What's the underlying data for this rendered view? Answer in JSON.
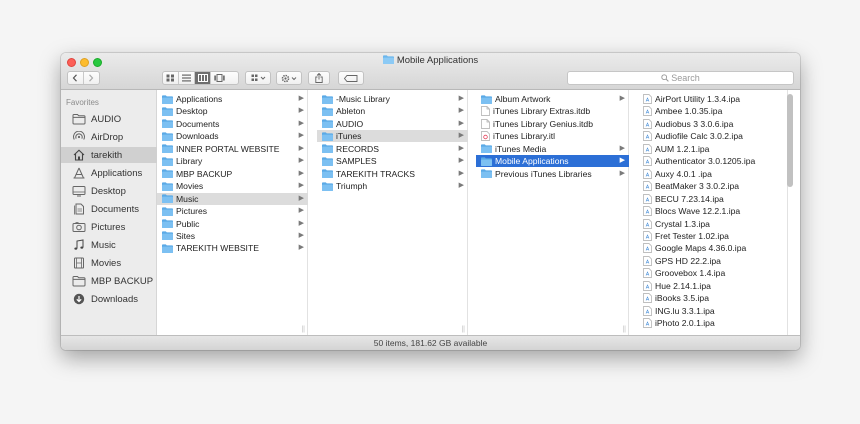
{
  "window": {
    "title": "Mobile Applications"
  },
  "search": {
    "placeholder": "Search"
  },
  "sidebar": {
    "heading": "Favorites",
    "items": [
      {
        "label": "AUDIO",
        "icon": "folder-icon"
      },
      {
        "label": "AirDrop",
        "icon": "airdrop-icon"
      },
      {
        "label": "tarekith",
        "icon": "home-icon",
        "selected": true
      },
      {
        "label": "Applications",
        "icon": "applications-icon"
      },
      {
        "label": "Desktop",
        "icon": "desktop-icon"
      },
      {
        "label": "Documents",
        "icon": "documents-icon"
      },
      {
        "label": "Pictures",
        "icon": "pictures-icon"
      },
      {
        "label": "Music",
        "icon": "music-icon"
      },
      {
        "label": "Movies",
        "icon": "movies-icon"
      },
      {
        "label": "MBP BACKUP",
        "icon": "folder-icon"
      },
      {
        "label": "Downloads",
        "icon": "downloads-icon"
      }
    ]
  },
  "columns": [
    {
      "items": [
        {
          "label": "Applications",
          "type": "folder"
        },
        {
          "label": "Desktop",
          "type": "folder"
        },
        {
          "label": "Documents",
          "type": "folder"
        },
        {
          "label": "Downloads",
          "type": "folder"
        },
        {
          "label": "INNER PORTAL WEBSITE",
          "type": "folder"
        },
        {
          "label": "Library",
          "type": "folder"
        },
        {
          "label": "MBP BACKUP",
          "type": "folder"
        },
        {
          "label": "Movies",
          "type": "folder"
        },
        {
          "label": "Music",
          "type": "folder",
          "selected": "grey"
        },
        {
          "label": "Pictures",
          "type": "folder"
        },
        {
          "label": "Public",
          "type": "folder"
        },
        {
          "label": "Sites",
          "type": "folder"
        },
        {
          "label": "TAREKITH WEBSITE",
          "type": "folder"
        }
      ]
    },
    {
      "items": [
        {
          "label": "-Music Library",
          "type": "folder"
        },
        {
          "label": "Ableton",
          "type": "folder"
        },
        {
          "label": "AUDIO",
          "type": "folder"
        },
        {
          "label": "iTunes",
          "type": "folder",
          "selected": "grey"
        },
        {
          "label": "RECORDS",
          "type": "folder"
        },
        {
          "label": "SAMPLES",
          "type": "folder"
        },
        {
          "label": "TAREKITH TRACKS",
          "type": "folder"
        },
        {
          "label": "Triumph",
          "type": "folder"
        }
      ]
    },
    {
      "items": [
        {
          "label": "Album Artwork",
          "type": "folder"
        },
        {
          "label": "iTunes Library Extras.itdb",
          "type": "file"
        },
        {
          "label": "iTunes Library Genius.itdb",
          "type": "file"
        },
        {
          "label": "iTunes Library.itl",
          "type": "itl"
        },
        {
          "label": "iTunes Media",
          "type": "folder"
        },
        {
          "label": "Mobile Applications",
          "type": "folder",
          "selected": "blue"
        },
        {
          "label": "Previous iTunes Libraries",
          "type": "folder"
        }
      ]
    },
    {
      "items": [
        {
          "label": "AirPort Utility 1.3.4.ipa",
          "type": "ipa"
        },
        {
          "label": "Ambee 1.0.35.ipa",
          "type": "ipa"
        },
        {
          "label": "Audiobus 3 3.0.6.ipa",
          "type": "ipa"
        },
        {
          "label": "Audiofile Calc 3.0.2.ipa",
          "type": "ipa"
        },
        {
          "label": "AUM 1.2.1.ipa",
          "type": "ipa"
        },
        {
          "label": "Authenticator 3.0.1205.ipa",
          "type": "ipa"
        },
        {
          "label": "Auxy 4.0.1 .ipa",
          "type": "ipa"
        },
        {
          "label": "BeatMaker 3 3.0.2.ipa",
          "type": "ipa"
        },
        {
          "label": "BECU 7.23.14.ipa",
          "type": "ipa"
        },
        {
          "label": "Blocs Wave 12.2.1.ipa",
          "type": "ipa"
        },
        {
          "label": "Crystal 1.3.ipa",
          "type": "ipa"
        },
        {
          "label": "Fret Tester 1.02.ipa",
          "type": "ipa"
        },
        {
          "label": "Google Maps 4.36.0.ipa",
          "type": "ipa"
        },
        {
          "label": "GPS HD 22.2.ipa",
          "type": "ipa"
        },
        {
          "label": "Groovebox 1.4.ipa",
          "type": "ipa"
        },
        {
          "label": "Hue 2.14.1.ipa",
          "type": "ipa"
        },
        {
          "label": "iBooks 3.5.ipa",
          "type": "ipa"
        },
        {
          "label": "ING.lu 3.3.1.ipa",
          "type": "ipa"
        },
        {
          "label": "iPhoto 2.0.1.ipa",
          "type": "ipa"
        }
      ]
    }
  ],
  "status": {
    "text": "50 items, 181.62 GB available"
  },
  "colors": {
    "selection_blue": "#2c6fd6",
    "selection_grey": "#dcdcdc",
    "folder": "#6bb6ec"
  }
}
